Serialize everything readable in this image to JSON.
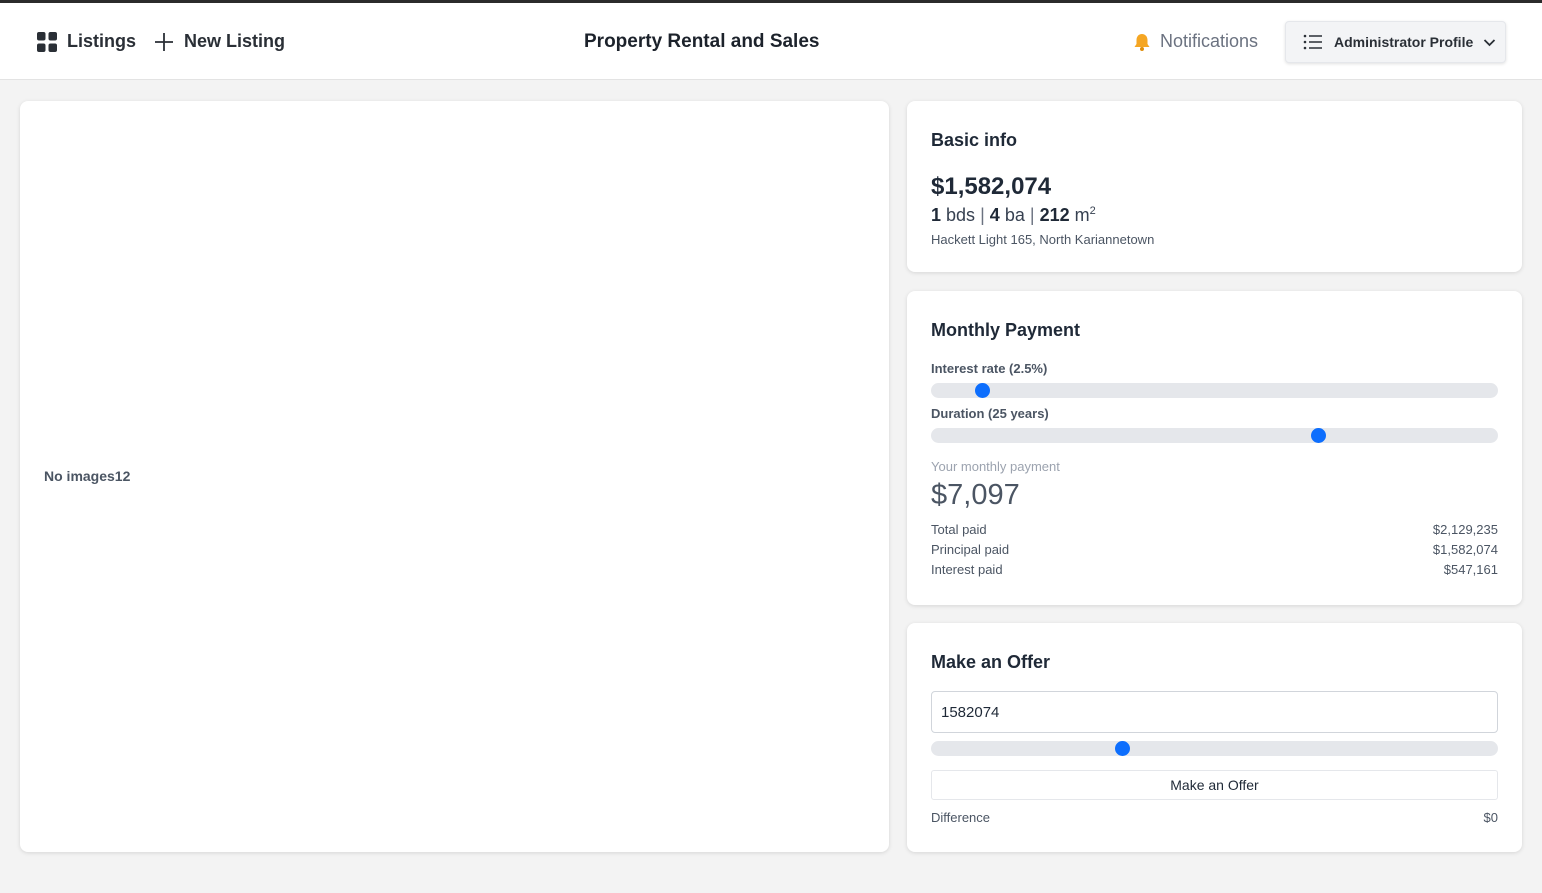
{
  "nav": {
    "listings_label": "Listings",
    "new_listing_label": "New Listing"
  },
  "header": {
    "title": "Property Rental and Sales",
    "notifications_label": "Notifications",
    "profile_label": "Administrator Profile"
  },
  "gallery": {
    "empty_text": "No images12"
  },
  "basic_info": {
    "heading": "Basic info",
    "price": "$1,582,074",
    "beds": "1",
    "beds_unit": "bds",
    "baths": "4",
    "baths_unit": "ba",
    "area": "212",
    "area_unit": "m",
    "area_exp": "2",
    "address": "Hackett Light 165, North Kariannetown"
  },
  "monthly_payment": {
    "heading": "Monthly Payment",
    "interest_label": "Interest rate (2.5%)",
    "interest_fraction": 0.09,
    "duration_label": "Duration (25 years)",
    "duration_fraction": 0.682,
    "caption": "Your monthly payment",
    "amount": "$7,097",
    "rows": [
      {
        "label": "Total paid",
        "value": "$2,129,235"
      },
      {
        "label": "Principal paid",
        "value": "$1,582,074"
      },
      {
        "label": "Interest paid",
        "value": "$547,161"
      }
    ]
  },
  "offer": {
    "heading": "Make an Offer",
    "input_value": "1582074",
    "slider_fraction": 0.337,
    "button_label": "Make an Offer",
    "difference_label": "Difference",
    "difference_value": "$0"
  },
  "colors": {
    "accent": "#0d6efd",
    "track": "#e5e7eb",
    "bell": "#f5a623"
  },
  "icons": {
    "listings": "grid-icon",
    "new_listing": "plus-icon",
    "notifications": "bell-icon",
    "profile": "list-icon",
    "profile_caret": "chevron-down-icon"
  }
}
